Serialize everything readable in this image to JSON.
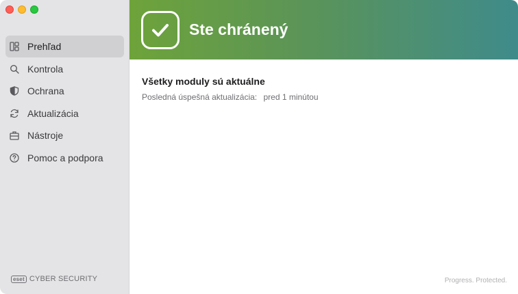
{
  "sidebar": {
    "items": [
      {
        "label": "Prehľad",
        "icon": "dashboard-icon",
        "active": true
      },
      {
        "label": "Kontrola",
        "icon": "search-icon",
        "active": false
      },
      {
        "label": "Ochrana",
        "icon": "shield-icon",
        "active": false
      },
      {
        "label": "Aktualizácia",
        "icon": "refresh-icon",
        "active": false
      },
      {
        "label": "Nástroje",
        "icon": "briefcase-icon",
        "active": false
      },
      {
        "label": "Pomoc a podpora",
        "icon": "help-icon",
        "active": false
      }
    ],
    "brand": {
      "logo_text": "eset",
      "product_name": "CYBER SECURITY"
    }
  },
  "banner": {
    "title": "Ste chránený",
    "icon": "checkmark-icon",
    "color_start": "#6ea33a",
    "color_end": "#3f8b8b"
  },
  "main": {
    "status_title": "Všetky moduly sú aktuálne",
    "last_update_label": "Posledná úspešná aktualizácia:",
    "last_update_value": "pred 1 minútou"
  },
  "footer": {
    "tagline": "Progress. Protected."
  }
}
